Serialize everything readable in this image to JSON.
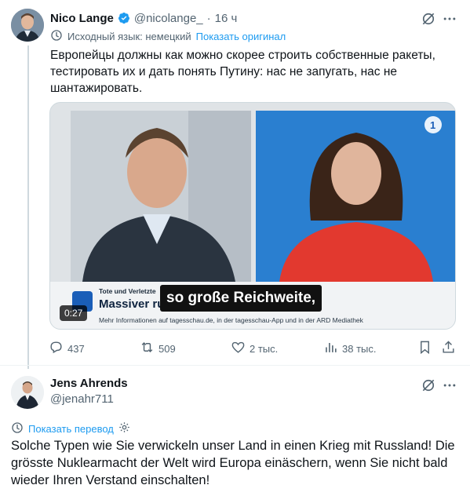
{
  "tweet1": {
    "author_name": "Nico Lange",
    "handle": "@nicolange_",
    "separator": "·",
    "time": "16 ч",
    "translate_prefix": "Исходный язык: немецкий",
    "translate_link": "Показать оригинал",
    "text": "Европейцы должны как можно скорее строить собственные ракеты, тестировать их и дать понять Путину: нас не запугать, нас не шантажировать.",
    "media": {
      "lower_third_small": "Tote und Verletzte",
      "lower_third_title": "Massiver russischer Angriff auf Kiew",
      "lower_third_info": "Mehr Informationen auf tagesschau.de, in der tagesschau-App und in der ARD Mediathek",
      "subtitle": "so große Reichweite,",
      "duration": "0:27"
    },
    "actions": {
      "replies": "437",
      "reposts": "509",
      "likes": "2 тыс.",
      "views": "38 тыс."
    }
  },
  "tweet2": {
    "author_name": "Jens Ahrends",
    "handle": "@jenahr711",
    "translate_link": "Показать перевод",
    "text": "Solche Typen wie Sie verwickeln unser Land in einen Krieg mit Russland! Die grösste Nuklearmacht der Welt wird Europa einäschern, wenn Sie nicht bald wieder Ihren Verstand einschalten!"
  },
  "colors": {
    "accent": "#1d9bf0",
    "secondary_text": "#536471",
    "primary_text": "#0f1419",
    "thread_line": "#cfd9de"
  },
  "icons": [
    "verified-badge-icon",
    "grok-icon",
    "more-icon",
    "translate-icon",
    "gear-icon",
    "reply-icon",
    "repost-icon",
    "like-icon",
    "views-icon",
    "bookmark-icon",
    "share-icon"
  ]
}
